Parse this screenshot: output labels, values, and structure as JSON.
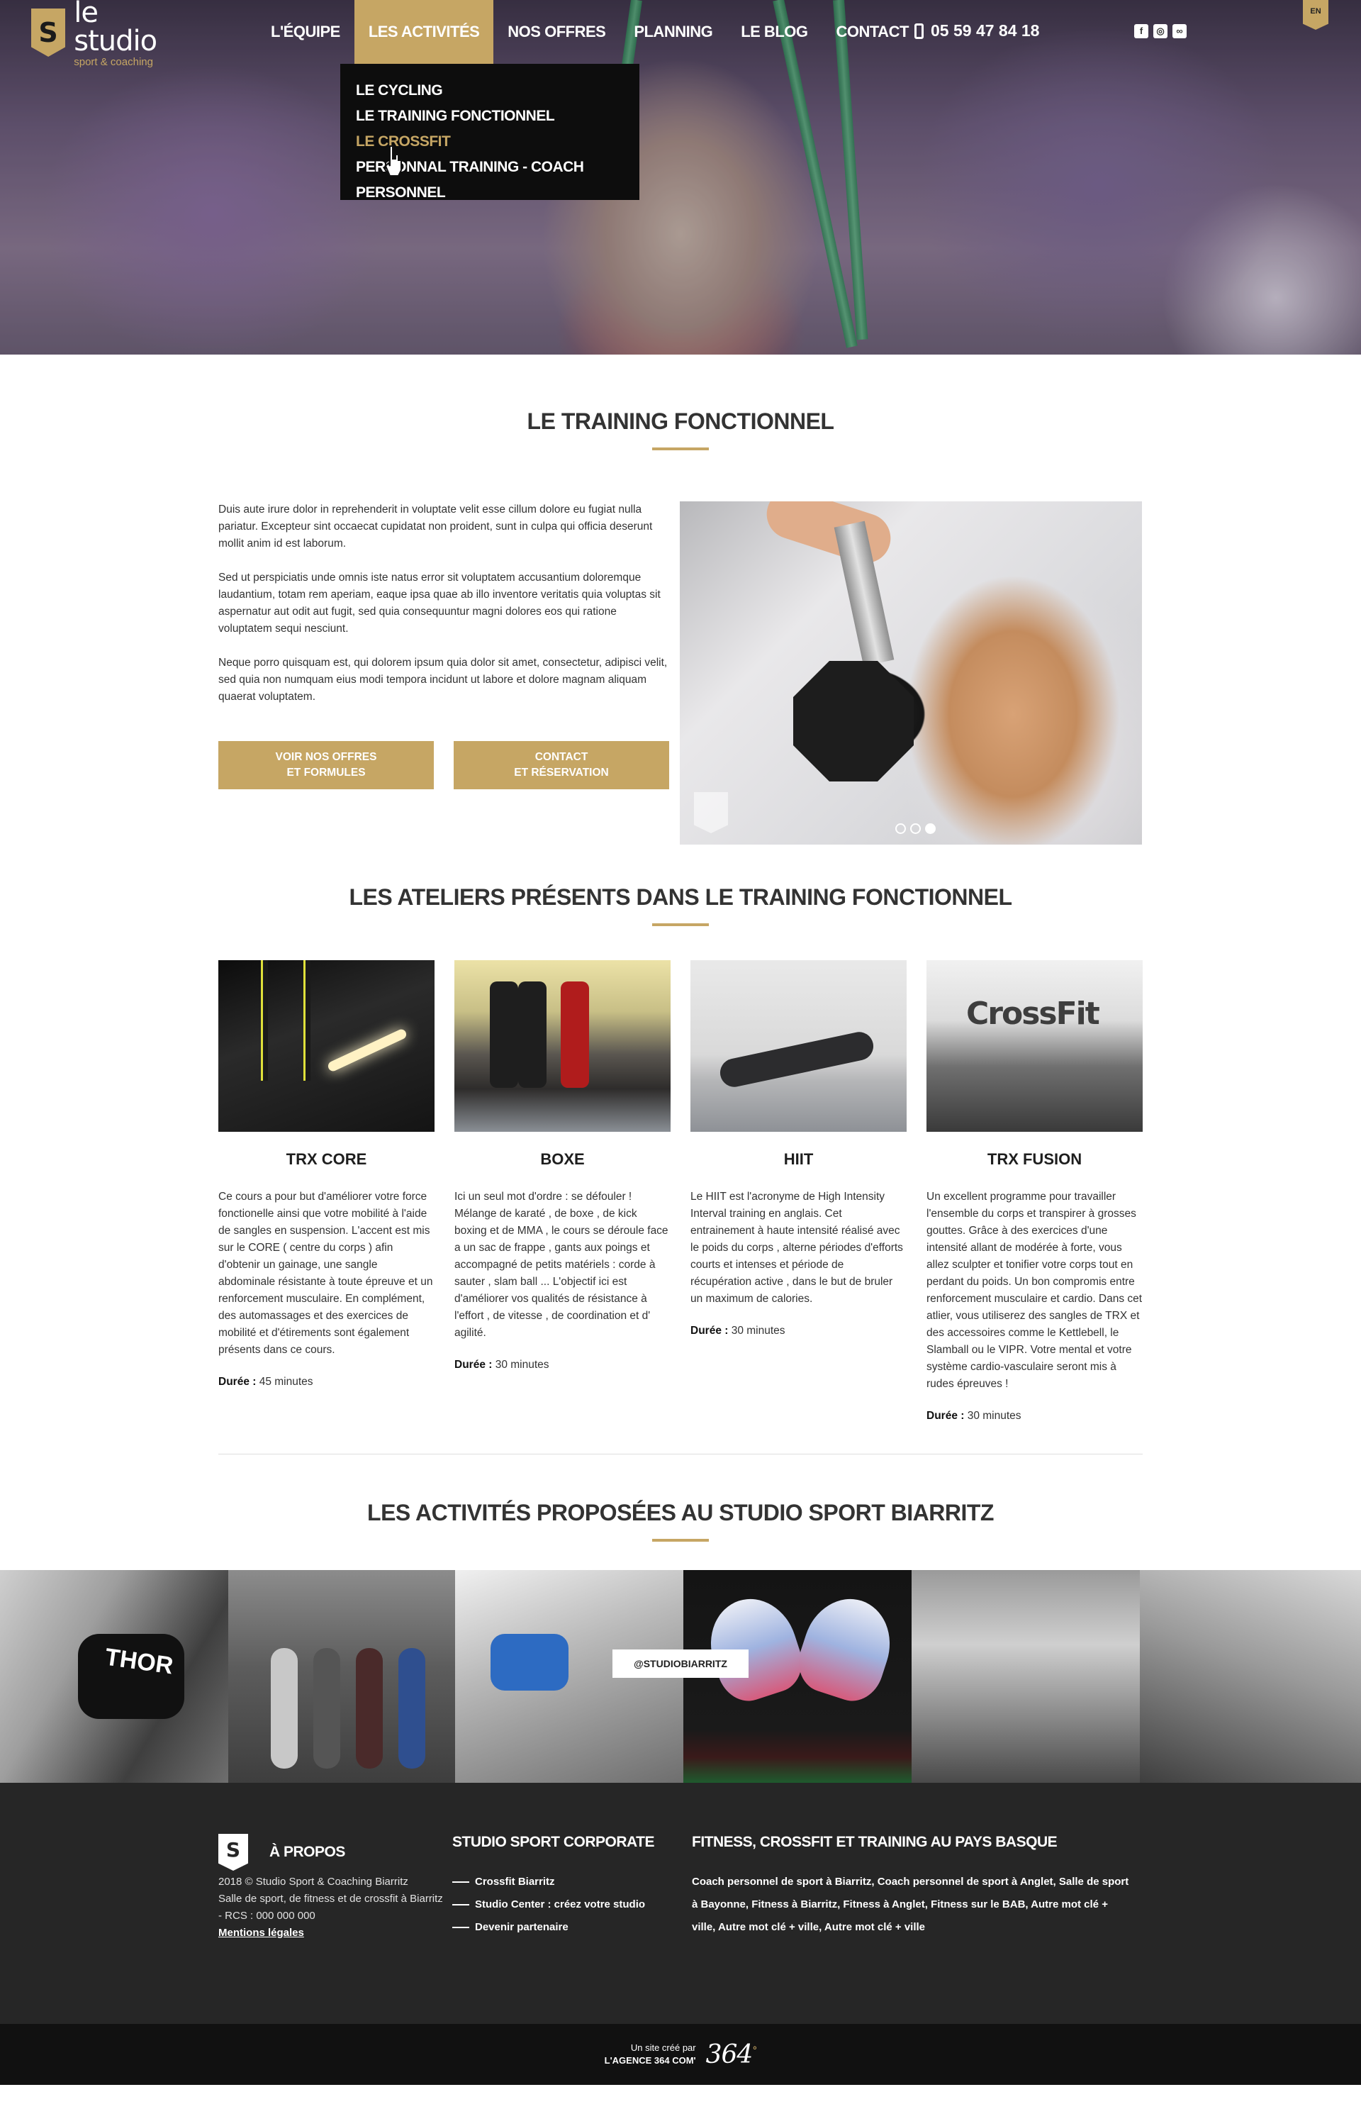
{
  "header": {
    "logo_mark": "S",
    "logo_title": "le studio",
    "logo_subtitle": "sport & coaching",
    "nav": [
      "L'ÉQUIPE",
      "LES ACTIVITÉS",
      "NOS OFFRES",
      "PLANNING",
      "LE BLOG",
      "CONTACT"
    ],
    "active_nav": "LES ACTIVITÉS",
    "phone": "05 59 47 84 18",
    "socials": [
      "facebook-icon",
      "instagram-icon",
      "tripadvisor-icon"
    ],
    "lang": "EN"
  },
  "dropdown": {
    "items": [
      "LE CYCLING",
      "LE TRAINING FONCTIONNEL",
      "LE CROSSFIT",
      "PERSONNAL TRAINING - COACH PERSONNEL"
    ],
    "highlighted": "LE CROSSFIT"
  },
  "intro": {
    "title": "LE TRAINING FONCTIONNEL",
    "paragraphs": [
      "Duis aute irure dolor in reprehenderit in voluptate velit esse cillum dolore eu fugiat nulla pariatur. Excepteur sint occaecat cupidatat non proident, sunt in culpa qui officia deserunt mollit anim id est laborum.",
      "Sed ut perspiciatis unde omnis iste natus error sit voluptatem accusantium doloremque laudantium, totam rem aperiam, eaque ipsa quae ab illo inventore veritatis quia voluptas sit aspernatur aut odit aut fugit, sed quia consequuntur magni dolores eos qui ratione voluptatem sequi nesciunt.",
      "Neque porro quisquam est, qui dolorem ipsum quia dolor sit amet, consectetur, adipisci velit, sed quia non numquam eius modi tempora incidunt ut labore et dolore magnam aliquam quaerat voluptatem."
    ],
    "button1_line1": "VOIR NOS OFFRES",
    "button1_line2": "ET FORMULES",
    "button2_line1": "CONTACT",
    "button2_line2": "ET RÉSERVATION",
    "slider_active": 3,
    "slider_count": 3
  },
  "ateliers": {
    "title": "LES ATELIERS PRÉSENTS DANS LE TRAINING FONCTIONNEL",
    "duration_label": "Durée :",
    "cards": [
      {
        "title": "TRX CORE",
        "body": "Ce cours a pour but d'améliorer votre force fonctionelle ainsi que votre mobilité à l'aide de sangles en suspension. L'accent est mis sur le CORE ( centre du corps ) afin d'obtenir un gainage, une sangle abdominale résistante à toute épreuve et un renforcement musculaire. En complément, des automassages et des exercices de mobilité et d'étirements sont également présents dans ce cours.",
        "duration": "45 minutes"
      },
      {
        "title": "BOXE",
        "body": "Ici un seul mot d'ordre : se défouler ! Mélange de karaté , de boxe , de kick boxing et de MMA , le cours se déroule face a un sac de frappe , gants aux poings et accompagné de petits matériels : corde à sauter , slam ball ... L'objectif ici est d'améliorer vos qualités de résistance à l'effort , de vitesse , de coordination et d' agilité.",
        "duration": "30 minutes"
      },
      {
        "title": "HIIT",
        "body": "Le HIIT est l'acronyme de High Intensity Interval training en anglais. Cet entrainement à haute intensité réalisé avec le poids du corps , alterne périodes d'efforts courts et intenses et période de récupération active , dans le but de bruler un maximum de calories.",
        "duration": "30 minutes"
      },
      {
        "title": "TRX FUSION",
        "body": "Un excellent programme pour travailler l'ensemble du corps et transpirer à grosses gouttes. Grâce à des exercices d'une intensité allant de modérée à forte, vous allez sculpter et tonifier votre corps tout en perdant du poids. Un bon compromis entre renforcement musculaire et cardio. Dans cet atlier, vous utiliserez des sangles de TRX et des accessoires comme le Kettlebell, le Slamball ou le VIPR. Votre mental et votre système cardio-vasculaire seront mis à rudes épreuves !",
        "duration": "30 minutes"
      }
    ],
    "fusion_sign": "CrossFit"
  },
  "activites": {
    "title": "LES ACTIVITÉS PROPOSÉES AU STUDIO SPORT BIARRITZ",
    "instagram_tag": "@STUDIOBIARRITZ",
    "shirt_text": "THOR"
  },
  "footer": {
    "col1_title": "À PROPOS",
    "col1_line1": "2018 © Studio Sport & Coaching Biarritz",
    "col1_line2": "Salle de sport, de fitness et de crossfit à Biarritz - RCS : 000 000 000",
    "col1_legal": "Mentions légales",
    "col2_title": "STUDIO SPORT CORPORATE",
    "col2_links": [
      "Crossfit Biarritz",
      "Studio Center : créez votre studio",
      "Devenir partenaire"
    ],
    "col3_title": "FITNESS, CROSSFIT ET TRAINING AU PAYS BASQUE",
    "col3_text": "Coach personnel de sport à Biarritz, Coach personnel de sport à Anglet, Salle de sport à Bayonne, Fitness à Biarritz, Fitness à Anglet, Fitness sur le BAB, Autre mot clé + ville, Autre mot clé + ville, Autre mot clé + ville"
  },
  "credit": {
    "line1": "Un site créé par",
    "line2": "L'AGENCE 364 COM'",
    "logo": "364",
    "logo_sup": "°"
  },
  "colors": {
    "accent": "#c6a664",
    "footer": "#262626",
    "bottom_bar": "#111111",
    "dropdown": "#0d0d0d"
  }
}
